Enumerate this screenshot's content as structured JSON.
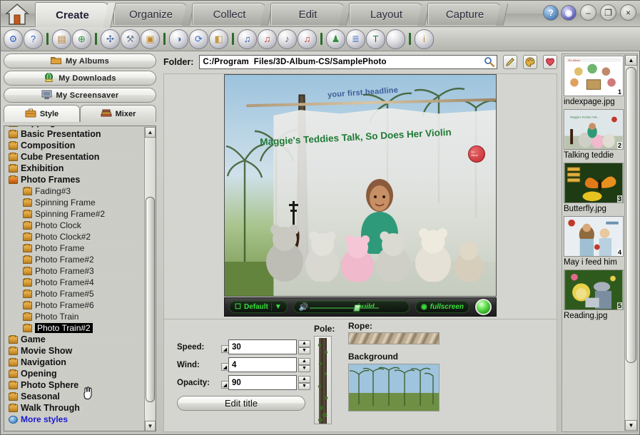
{
  "app": {
    "home_icon": "home-icon",
    "tabs": [
      {
        "label": "Create",
        "active": true
      },
      {
        "label": "Organize",
        "active": false
      },
      {
        "label": "Collect",
        "active": false
      },
      {
        "label": "Edit",
        "active": false
      },
      {
        "label": "Layout",
        "active": false
      },
      {
        "label": "Capture",
        "active": false
      }
    ],
    "window_buttons": [
      {
        "name": "help-icon",
        "glyph": "?"
      },
      {
        "name": "about-icon",
        "glyph": "◉"
      },
      {
        "name": "minimize-button",
        "glyph": "–"
      },
      {
        "name": "restore-button",
        "glyph": "❐"
      },
      {
        "name": "close-button",
        "glyph": "×"
      }
    ]
  },
  "toolbar": {
    "buttons": [
      {
        "name": "settings-gear-icon",
        "glyph": "⚙",
        "color": "#2f5fc0"
      },
      {
        "name": "help-question-icon",
        "glyph": "?",
        "color": "#2f5fc0"
      },
      {
        "sep": true
      },
      {
        "name": "album-case-icon",
        "glyph": "▤",
        "color": "#b07a2a"
      },
      {
        "name": "globe-web-icon",
        "glyph": "⊕",
        "color": "#2f8f3f"
      },
      {
        "sep": true
      },
      {
        "name": "resize-arrows-icon",
        "glyph": "✣",
        "color": "#4a6fa5"
      },
      {
        "name": "tools-hammer-icon",
        "glyph": "⚒",
        "color": "#6e7b8c"
      },
      {
        "name": "frame-photo-icon",
        "glyph": "▣",
        "color": "#c08a2a"
      },
      {
        "sep": true
      },
      {
        "name": "book-open-icon",
        "glyph": "◑",
        "color": "#3f6fb5"
      },
      {
        "name": "refresh-photo-icon",
        "glyph": "⟳",
        "color": "#2f6fc0"
      },
      {
        "name": "folder-image-icon",
        "glyph": "◧",
        "color": "#c29a46"
      },
      {
        "sep": true
      },
      {
        "name": "music-note-icon",
        "glyph": "♫",
        "color": "#2f4fb0"
      },
      {
        "name": "music-add-icon",
        "glyph": "♫",
        "color": "#c0392b"
      },
      {
        "name": "music-list-icon",
        "glyph": "♪",
        "color": "#5c5c6e"
      },
      {
        "name": "music-remove-icon",
        "glyph": "♫",
        "color": "#c0392b"
      },
      {
        "sep": true
      },
      {
        "name": "person-icon",
        "glyph": "♟",
        "color": "#2f8f3f"
      },
      {
        "name": "layers-icon",
        "glyph": "≣",
        "color": "#3f6fb5"
      },
      {
        "name": "text-tool-icon",
        "glyph": "T",
        "color": "#1f6f3f"
      },
      {
        "name": "blank-icon",
        "glyph": "",
        "color": "#bfbfc6"
      },
      {
        "sep": true
      },
      {
        "name": "info-icon",
        "glyph": "i",
        "color": "#c08a2a"
      }
    ]
  },
  "sidebar": {
    "buttons": [
      {
        "label": "My Albums",
        "icon": "folder-icon"
      },
      {
        "label": "My Downloads",
        "icon": "globe-icon"
      },
      {
        "label": "My Screensaver",
        "icon": "screensaver-icon"
      }
    ],
    "tabs": [
      {
        "label": "Style",
        "icon": "briefcase-icon",
        "active": true
      },
      {
        "label": "Mixer",
        "icon": "books-icon",
        "active": false
      }
    ],
    "tree": [
      {
        "label": "Flippingbo",
        "level": 0,
        "kind": "cat",
        "clipped": true
      },
      {
        "label": "Basic Presentation",
        "level": 0,
        "kind": "cat"
      },
      {
        "label": "Composition",
        "level": 0,
        "kind": "cat"
      },
      {
        "label": "Cube Presentation",
        "level": 0,
        "kind": "cat"
      },
      {
        "label": "Exhibition",
        "level": 0,
        "kind": "cat"
      },
      {
        "label": "Photo Frames",
        "level": 0,
        "kind": "cat",
        "open": true
      },
      {
        "label": "Fading#3",
        "level": 1,
        "kind": "child"
      },
      {
        "label": "Spinning Frame",
        "level": 1,
        "kind": "child"
      },
      {
        "label": "Spinning Frame#2",
        "level": 1,
        "kind": "child"
      },
      {
        "label": "Photo Clock",
        "level": 1,
        "kind": "child"
      },
      {
        "label": "Photo Clock#2",
        "level": 1,
        "kind": "child"
      },
      {
        "label": "Photo Frame",
        "level": 1,
        "kind": "child"
      },
      {
        "label": "Photo Frame#2",
        "level": 1,
        "kind": "child"
      },
      {
        "label": "Photo Frame#3",
        "level": 1,
        "kind": "child"
      },
      {
        "label": "Photo Frame#4",
        "level": 1,
        "kind": "child"
      },
      {
        "label": "Photo Frame#5",
        "level": 1,
        "kind": "child"
      },
      {
        "label": "Photo Frame#6",
        "level": 1,
        "kind": "child"
      },
      {
        "label": "Photo Train",
        "level": 1,
        "kind": "child"
      },
      {
        "label": "Photo Train#2",
        "level": 1,
        "kind": "child",
        "selected": true
      },
      {
        "label": "Game",
        "level": 0,
        "kind": "cat"
      },
      {
        "label": "Movie Show",
        "level": 0,
        "kind": "cat"
      },
      {
        "label": "Navigation",
        "level": 0,
        "kind": "cat"
      },
      {
        "label": "Opening",
        "level": 0,
        "kind": "cat"
      },
      {
        "label": "Photo Sphere",
        "level": 0,
        "kind": "cat"
      },
      {
        "label": "Seasonal",
        "level": 0,
        "kind": "cat"
      },
      {
        "label": "Walk Through",
        "level": 0,
        "kind": "cat"
      },
      {
        "label": "More styles",
        "level": 0,
        "kind": "more",
        "icon": "sphere-icon"
      }
    ]
  },
  "folder": {
    "label": "Folder:",
    "path": "C:/Program  Files/3D-Album-CS/SamplePhoto",
    "buttons": [
      {
        "name": "browse-folder-icon",
        "glyph": "🔍"
      },
      {
        "name": "edit-pencil-icon",
        "glyph": "✎"
      },
      {
        "name": "palette-icon",
        "glyph": "◕"
      },
      {
        "name": "favorite-heart-icon",
        "glyph": "♥"
      }
    ]
  },
  "preview": {
    "headline": "your first headline",
    "subheadline": "Maggie's Teddies Talk, So Does Her Violin",
    "stamp": "3D-Album"
  },
  "player": {
    "default_label": "Default",
    "dropdown_glyph": "▼",
    "build_label": "build",
    "fullscreen_label": "fullscreen",
    "lamp_name": "play-lamp"
  },
  "props": {
    "fields": [
      {
        "label": "Speed:",
        "value": "30",
        "name": "speed"
      },
      {
        "label": "Wind:",
        "value": "4",
        "name": "wind"
      },
      {
        "label": "Opacity:",
        "value": "90",
        "name": "opacity"
      }
    ],
    "edit_title_label": "Edit title",
    "pole_label": "Pole:",
    "rope_label": "Rope:",
    "background_label": "Background"
  },
  "thumbnails": [
    {
      "index": "1",
      "caption": "indexpage.jpg",
      "kind": "index"
    },
    {
      "index": "2",
      "caption": "Talking teddie",
      "kind": "teddies"
    },
    {
      "index": "3",
      "caption": "Butterfly.jpg",
      "kind": "butterfly"
    },
    {
      "index": "4",
      "caption": "May i feed him",
      "kind": "feed"
    },
    {
      "index": "5",
      "caption": "Reading.jpg",
      "kind": "reading"
    }
  ],
  "scrollbars": {
    "up_glyph": "▲",
    "down_glyph": "▼"
  }
}
